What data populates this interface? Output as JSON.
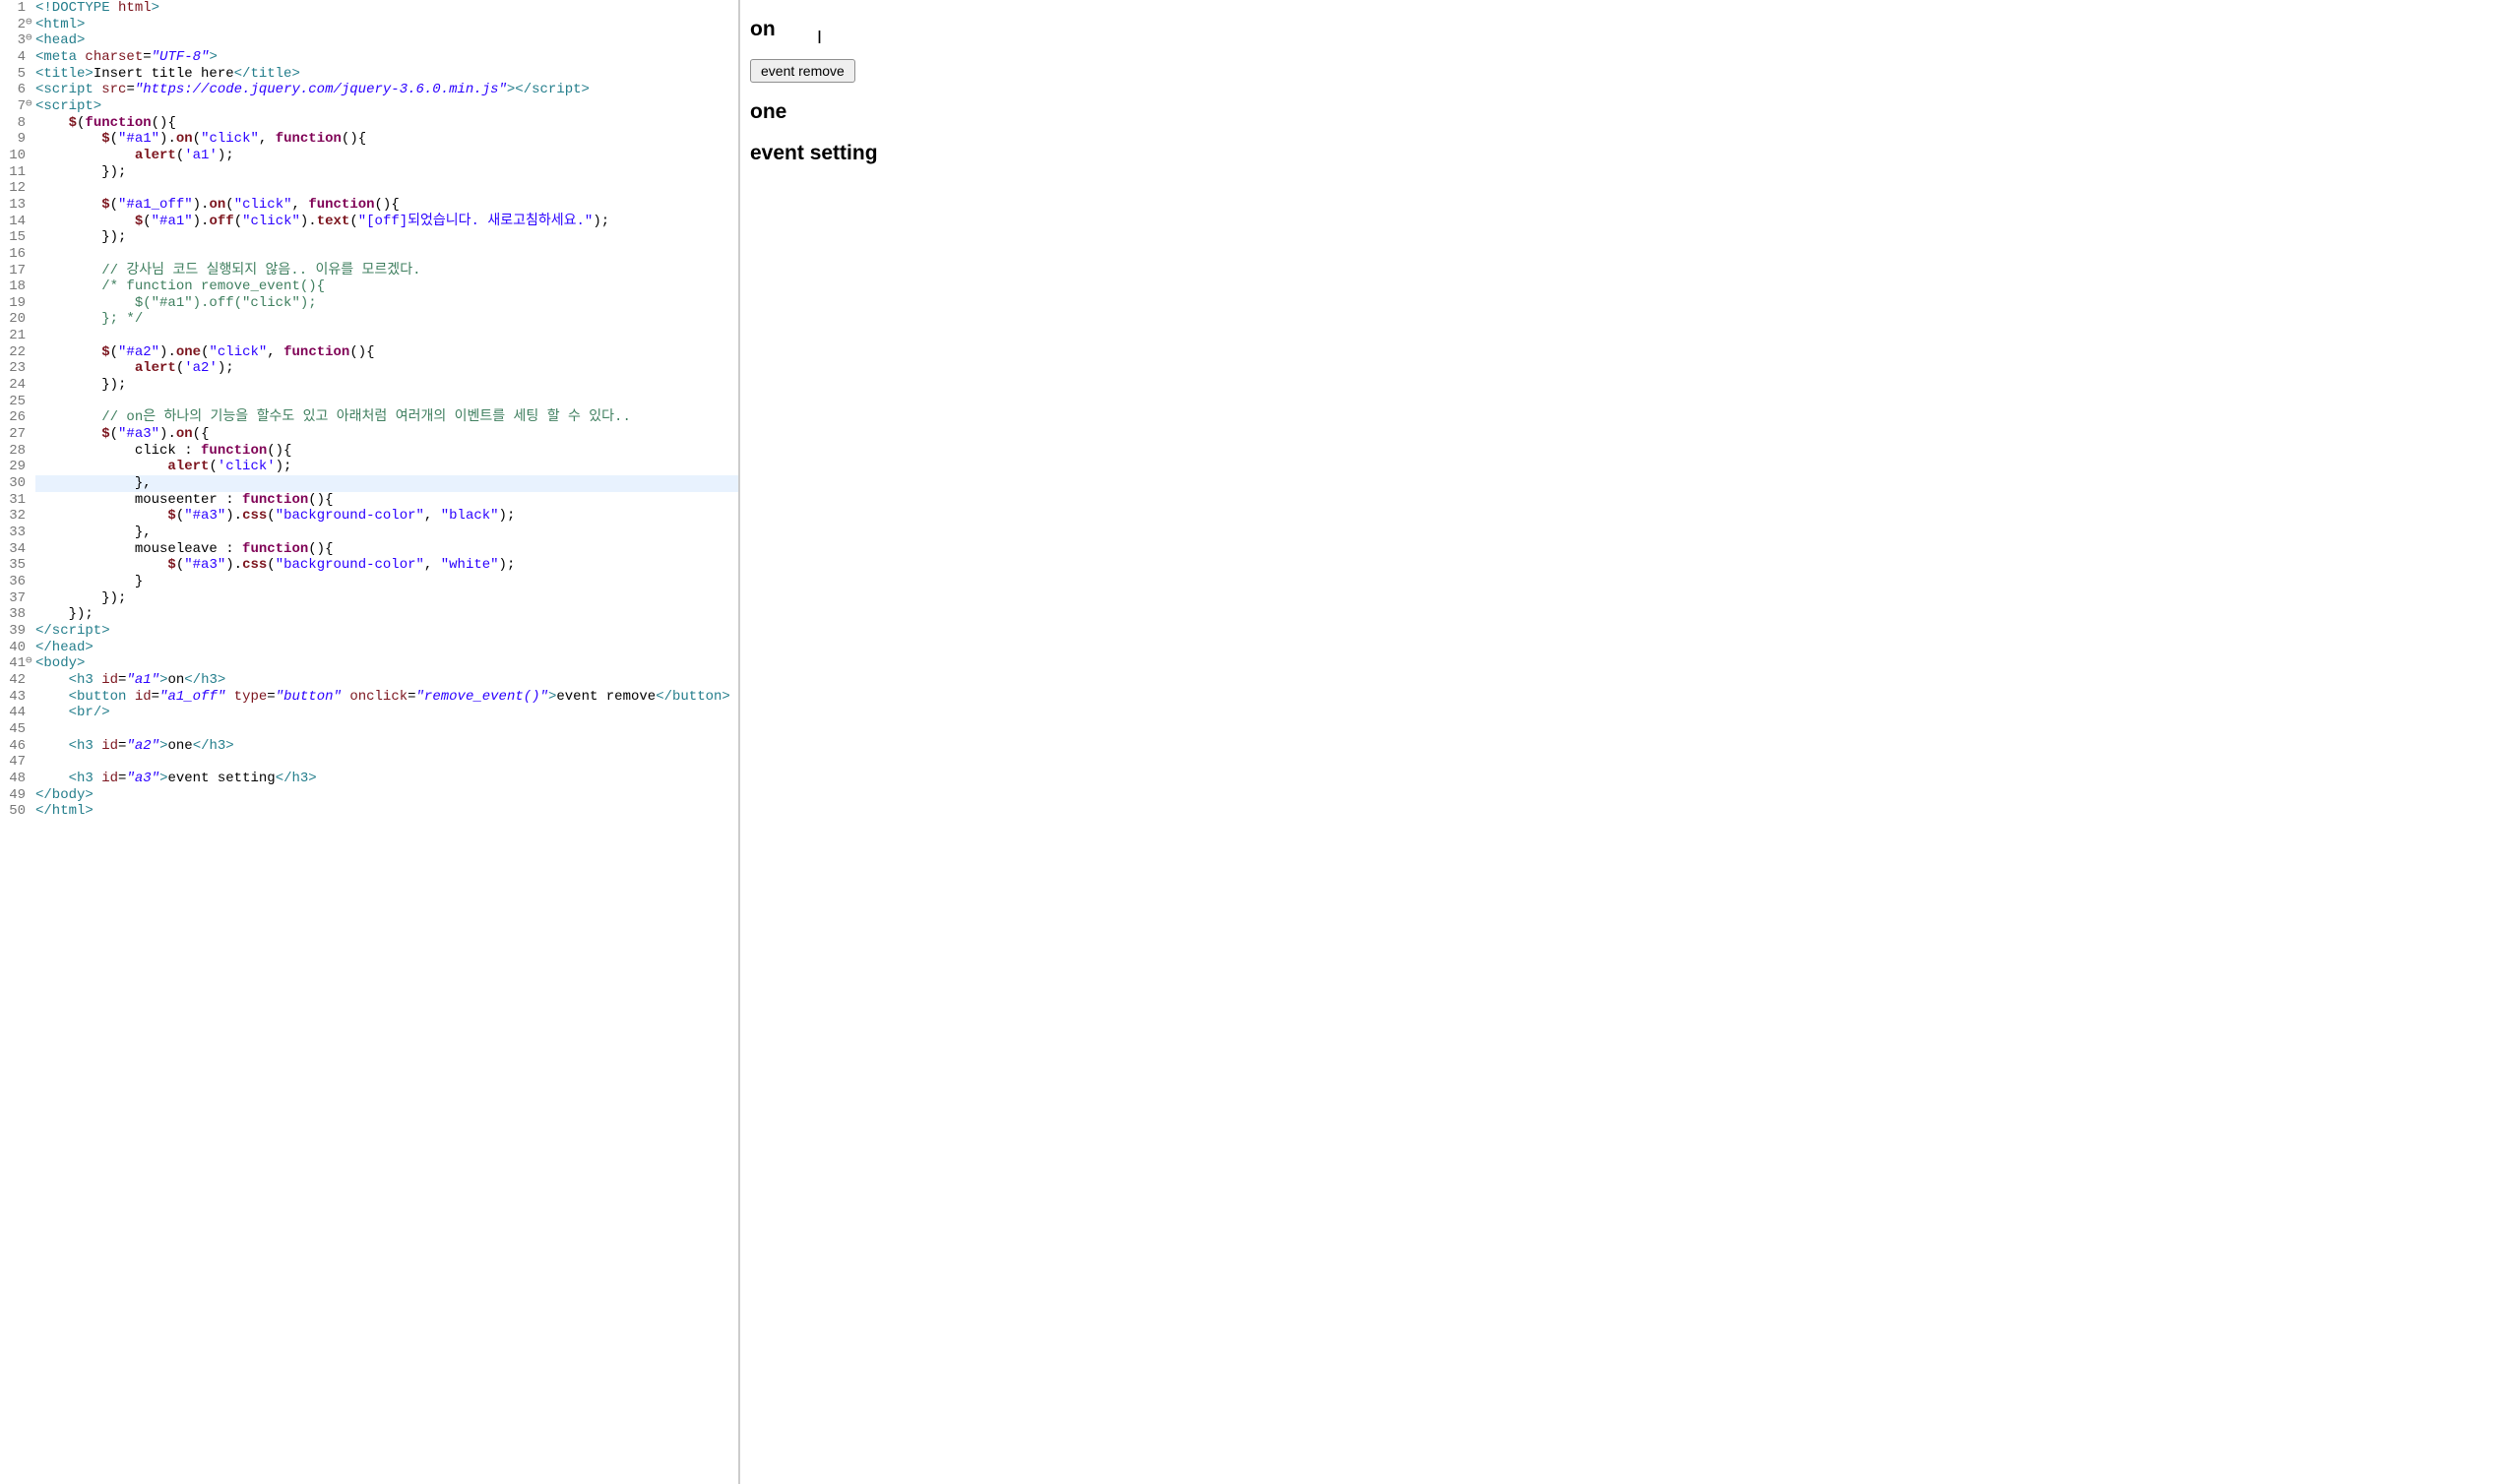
{
  "editor": {
    "highlighted_line": 30,
    "lines": [
      {
        "n": 1,
        "fold": "",
        "html": "<span class='tag'>&lt;!DOCTYPE</span> <span class='attr'>html</span><span class='tag'>&gt;</span>"
      },
      {
        "n": 2,
        "fold": "⊖",
        "html": "<span class='tag'>&lt;html&gt;</span>"
      },
      {
        "n": 3,
        "fold": "⊖",
        "html": "<span class='tag'>&lt;head&gt;</span>"
      },
      {
        "n": 4,
        "fold": "",
        "html": "<span class='tag'>&lt;meta</span> <span class='attr'>charset</span>=<span class='strv'>\"UTF-8\"</span><span class='tag'>&gt;</span>"
      },
      {
        "n": 5,
        "fold": "",
        "html": "<span class='tag'>&lt;title&gt;</span>Insert title here<span class='tag'>&lt;/title&gt;</span>"
      },
      {
        "n": 6,
        "fold": "",
        "html": "<span class='tag'>&lt;script</span> <span class='attr'>src</span>=<span class='strv'>\"https://code.jquery.com/jquery-3.6.0.min.js\"</span><span class='tag'>&gt;&lt;/script&gt;</span>"
      },
      {
        "n": 7,
        "fold": "⊖",
        "html": "<span class='tag'>&lt;script&gt;</span>"
      },
      {
        "n": 8,
        "fold": "",
        "html": "    <span class='fn'>$</span>(<span class='kw'>function</span>(){"
      },
      {
        "n": 9,
        "fold": "",
        "html": "        <span class='fn'>$</span>(<span class='str2'>\"#a1\"</span>).<span class='fn'>on</span>(<span class='str2'>\"click\"</span>, <span class='kw'>function</span>(){"
      },
      {
        "n": 10,
        "fold": "",
        "html": "            <span class='fn'>alert</span>(<span class='str2'>'a1'</span>);"
      },
      {
        "n": 11,
        "fold": "",
        "html": "        });"
      },
      {
        "n": 12,
        "fold": "",
        "html": ""
      },
      {
        "n": 13,
        "fold": "",
        "html": "        <span class='fn'>$</span>(<span class='str2'>\"#a1_off\"</span>).<span class='fn'>on</span>(<span class='str2'>\"click\"</span>, <span class='kw'>function</span>(){"
      },
      {
        "n": 14,
        "fold": "",
        "html": "            <span class='fn'>$</span>(<span class='str2'>\"#a1\"</span>).<span class='fn'>off</span>(<span class='str2'>\"click\"</span>).<span class='fn'>text</span>(<span class='str2'>\"[off]되었습니다. 새로고침하세요.\"</span>);"
      },
      {
        "n": 15,
        "fold": "",
        "html": "        });"
      },
      {
        "n": 16,
        "fold": "",
        "html": ""
      },
      {
        "n": 17,
        "fold": "",
        "html": "        <span class='cmt'>// 강사님 코드 실행되지 않음.. 이유를 모르겠다.</span>"
      },
      {
        "n": 18,
        "fold": "",
        "html": "        <span class='cmt'>/* function remove_event(){</span>"
      },
      {
        "n": 19,
        "fold": "",
        "html": "<span class='cmt'>            $(\"#a1\").off(\"click\");</span>"
      },
      {
        "n": 20,
        "fold": "",
        "html": "<span class='cmt'>        }; */</span>"
      },
      {
        "n": 21,
        "fold": "",
        "html": ""
      },
      {
        "n": 22,
        "fold": "",
        "html": "        <span class='fn'>$</span>(<span class='str2'>\"#a2\"</span>).<span class='fn'>one</span>(<span class='str2'>\"click\"</span>, <span class='kw'>function</span>(){"
      },
      {
        "n": 23,
        "fold": "",
        "html": "            <span class='fn'>alert</span>(<span class='str2'>'a2'</span>);"
      },
      {
        "n": 24,
        "fold": "",
        "html": "        });"
      },
      {
        "n": 25,
        "fold": "",
        "html": ""
      },
      {
        "n": 26,
        "fold": "",
        "html": "        <span class='cmt'>// on은 하나의 기능을 할수도 있고 아래처럼 여러개의 이벤트를 세팅 할 수 있다..</span>"
      },
      {
        "n": 27,
        "fold": "",
        "html": "        <span class='fn'>$</span>(<span class='str2'>\"#a3\"</span>).<span class='fn'>on</span>({"
      },
      {
        "n": 28,
        "fold": "",
        "html": "            click : <span class='kw'>function</span>(){"
      },
      {
        "n": 29,
        "fold": "",
        "html": "                <span class='fn'>alert</span>(<span class='str2'>'click'</span>);"
      },
      {
        "n": 30,
        "fold": "",
        "html": "            },"
      },
      {
        "n": 31,
        "fold": "",
        "html": "            mouseenter : <span class='kw'>function</span>(){"
      },
      {
        "n": 32,
        "fold": "",
        "html": "                <span class='fn'>$</span>(<span class='str2'>\"#a3\"</span>).<span class='fn'>css</span>(<span class='str2'>\"background-color\"</span>, <span class='str2'>\"black\"</span>);"
      },
      {
        "n": 33,
        "fold": "",
        "html": "            },"
      },
      {
        "n": 34,
        "fold": "",
        "html": "            mouseleave : <span class='kw'>function</span>(){"
      },
      {
        "n": 35,
        "fold": "",
        "html": "                <span class='fn'>$</span>(<span class='str2'>\"#a3\"</span>).<span class='fn'>css</span>(<span class='str2'>\"background-color\"</span>, <span class='str2'>\"white\"</span>);"
      },
      {
        "n": 36,
        "fold": "",
        "html": "            }"
      },
      {
        "n": 37,
        "fold": "",
        "html": "        });"
      },
      {
        "n": 38,
        "fold": "",
        "html": "    });"
      },
      {
        "n": 39,
        "fold": "",
        "html": "<span class='tag'>&lt;/script&gt;</span>"
      },
      {
        "n": 40,
        "fold": "",
        "html": "<span class='tag'>&lt;/head&gt;</span>"
      },
      {
        "n": 41,
        "fold": "⊖",
        "html": "<span class='tag'>&lt;body&gt;</span>"
      },
      {
        "n": 42,
        "fold": "",
        "html": "    <span class='tag'>&lt;h3</span> <span class='attr'>id</span>=<span class='strv'>\"a1\"</span><span class='tag'>&gt;</span>on<span class='tag'>&lt;/h3&gt;</span>"
      },
      {
        "n": 43,
        "fold": "",
        "html": "    <span class='tag'>&lt;button</span> <span class='attr'>id</span>=<span class='strv'>\"a1_off\"</span> <span class='attr'>type</span>=<span class='strv'>\"button\"</span> <span class='attr'>onclick</span>=<span class='strv'>\"remove_event()\"</span><span class='tag'>&gt;</span>event remove<span class='tag'>&lt;/button&gt;</span>"
      },
      {
        "n": 44,
        "fold": "",
        "html": "    <span class='tag'>&lt;br/&gt;</span>"
      },
      {
        "n": 45,
        "fold": "",
        "html": ""
      },
      {
        "n": 46,
        "fold": "",
        "html": "    <span class='tag'>&lt;h3</span> <span class='attr'>id</span>=<span class='strv'>\"a2\"</span><span class='tag'>&gt;</span>one<span class='tag'>&lt;/h3&gt;</span>"
      },
      {
        "n": 47,
        "fold": "",
        "html": ""
      },
      {
        "n": 48,
        "fold": "",
        "html": "    <span class='tag'>&lt;h3</span> <span class='attr'>id</span>=<span class='strv'>\"a3\"</span><span class='tag'>&gt;</span>event setting<span class='tag'>&lt;/h3&gt;</span>"
      },
      {
        "n": 49,
        "fold": "",
        "html": "<span class='tag'>&lt;/body&gt;</span>"
      },
      {
        "n": 50,
        "fold": "",
        "html": "<span class='tag'>&lt;/html&gt;</span>"
      }
    ]
  },
  "preview": {
    "h_on": "on",
    "btn_remove": "event remove",
    "h_one": "one",
    "h_event_setting": "event setting"
  }
}
